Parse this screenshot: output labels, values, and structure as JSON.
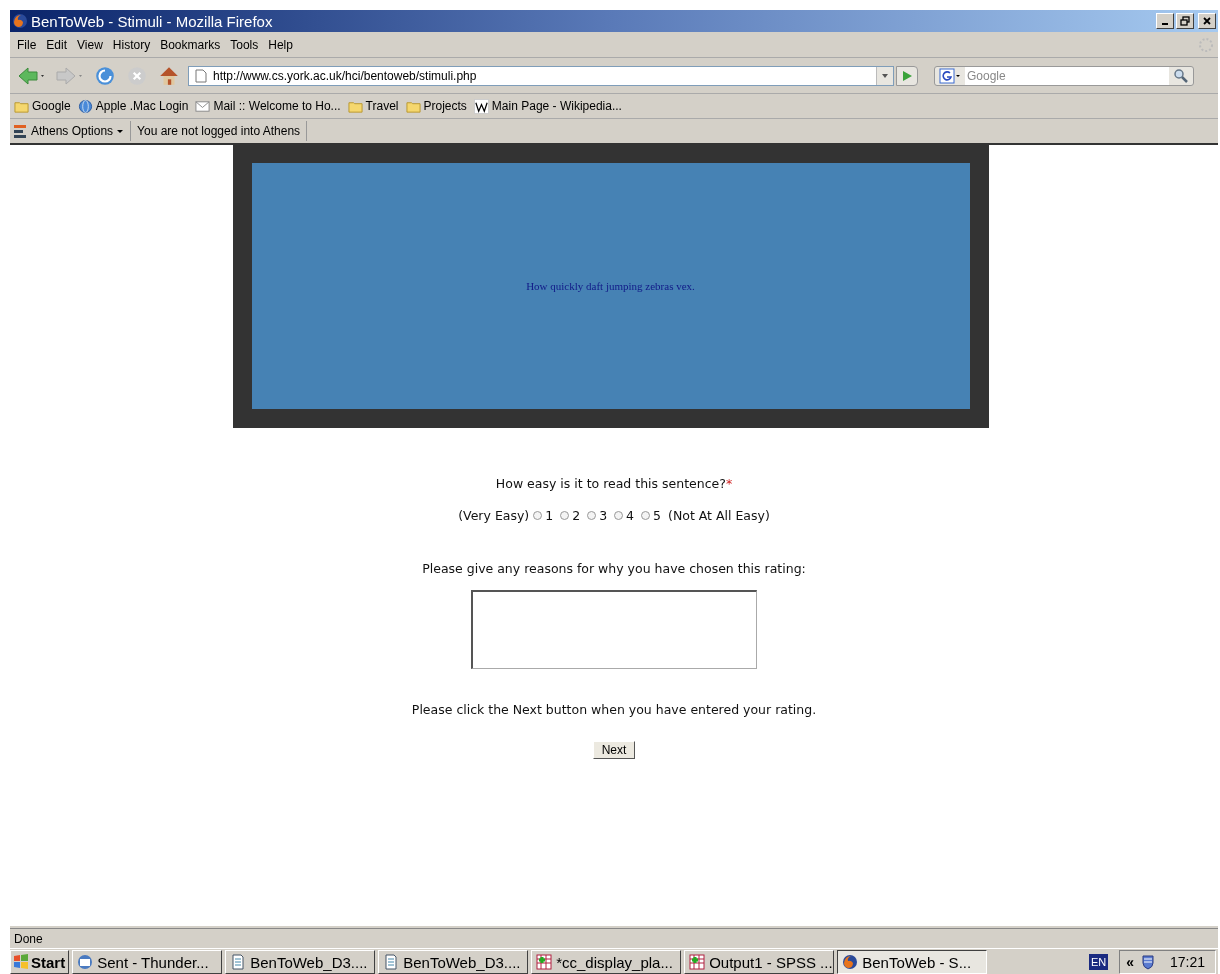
{
  "window": {
    "title": "BenToWeb - Stimuli - Mozilla Firefox"
  },
  "menu": [
    "File",
    "Edit",
    "View",
    "History",
    "Bookmarks",
    "Tools",
    "Help"
  ],
  "address": {
    "value": "http://www.cs.york.ac.uk/hci/bentoweb/stimuli.php"
  },
  "search": {
    "placeholder": "Google"
  },
  "bookmarks": [
    {
      "label": "Google",
      "kind": "folder"
    },
    {
      "label": "Apple .Mac Login",
      "kind": "globe"
    },
    {
      "label": "Mail :: Welcome to Ho...",
      "kind": "mail"
    },
    {
      "label": "Travel",
      "kind": "folder"
    },
    {
      "label": "Projects",
      "kind": "folder"
    },
    {
      "label": "Main Page - Wikipedia...",
      "kind": "wiki"
    }
  ],
  "athens_bar": {
    "menu": "Athens Options",
    "status": "You are not logged into Athens"
  },
  "stimulus": {
    "text": "How quickly daft jumping zebras vex."
  },
  "question": {
    "text": "How easy is it to read this sentence?",
    "required_mark": "*"
  },
  "rating": {
    "low_label": "(Very Easy)",
    "high_label": "(Not At All Easy)",
    "options": [
      {
        "label": "1",
        "selected": false
      },
      {
        "label": "2",
        "selected": false
      },
      {
        "label": "3",
        "selected": false
      },
      {
        "label": "4",
        "selected": false
      },
      {
        "label": "5",
        "selected": false
      }
    ]
  },
  "reasons": {
    "prompt": "Please give any reasons for why you have chosen this rating:"
  },
  "instruction": "Please click the Next button when you have entered your rating.",
  "next_button": "Next",
  "status_bar": "Done",
  "taskbar": {
    "start": "Start",
    "tasks": [
      {
        "label": "Sent - Thunder...",
        "kind": "mail",
        "selected": false
      },
      {
        "label": "BenToWeb_D3....",
        "kind": "doc",
        "selected": false
      },
      {
        "label": "BenToWeb_D3....",
        "kind": "doc",
        "selected": false
      },
      {
        "label": "*cc_display_pla...",
        "kind": "sheet",
        "selected": false
      },
      {
        "label": "Output1 - SPSS ...",
        "kind": "sheet",
        "selected": false
      },
      {
        "label": "BenToWeb - S...",
        "kind": "browser",
        "selected": true
      }
    ],
    "language": "EN",
    "clock": "17:21",
    "tray_toggle": "«"
  }
}
